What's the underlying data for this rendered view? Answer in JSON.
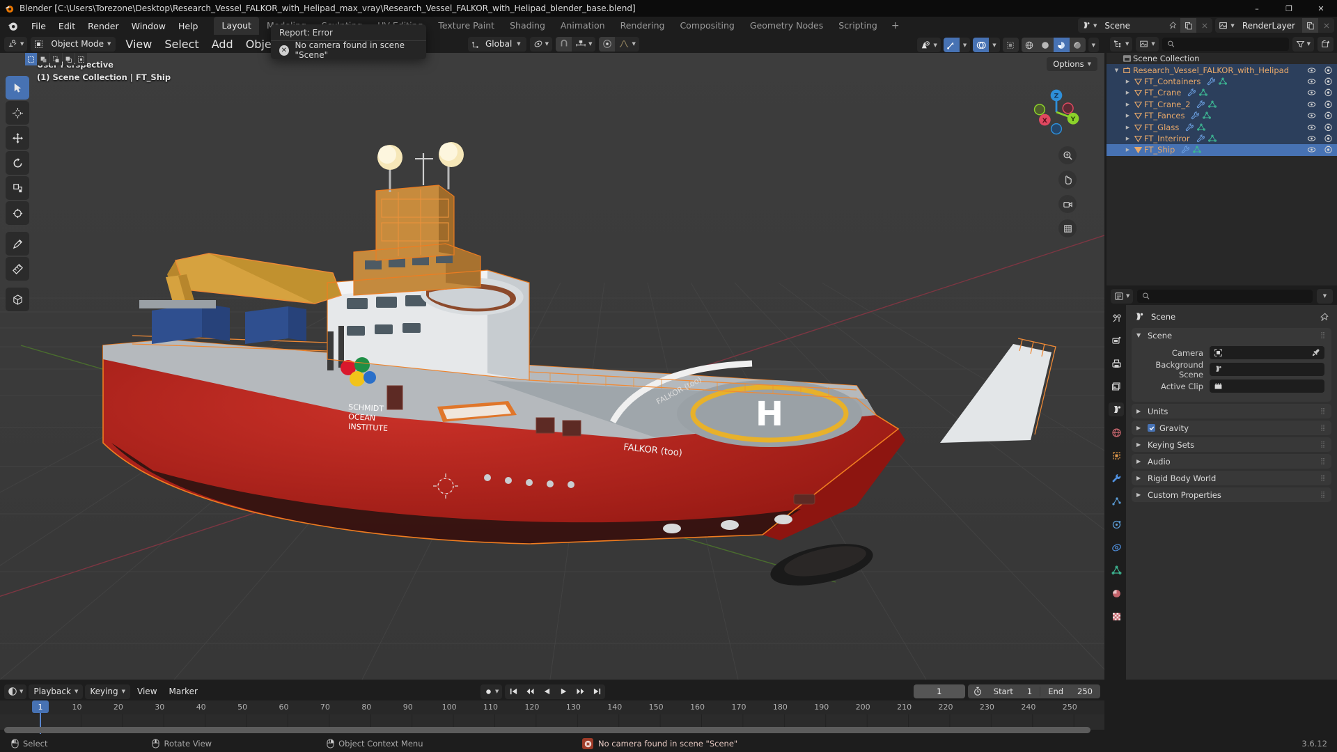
{
  "window": {
    "title": "Blender [C:\\Users\\Torezone\\Desktop\\Research_Vessel_FALKOR_with_Helipad_max_vray\\Research_Vessel_FALKOR_with_Helipad_blender_base.blend]",
    "minimize": "–",
    "maximize": "❐",
    "close": "✕"
  },
  "topbar": {
    "menus": [
      "File",
      "Edit",
      "Render",
      "Window",
      "Help"
    ],
    "workspaces": [
      {
        "label": "Layout",
        "active": true
      },
      {
        "label": "Modeling",
        "active": false
      },
      {
        "label": "Sculpting",
        "active": false
      },
      {
        "label": "UV Editing",
        "active": false
      },
      {
        "label": "Texture Paint",
        "active": false
      },
      {
        "label": "Shading",
        "active": false
      },
      {
        "label": "Animation",
        "active": false
      },
      {
        "label": "Rendering",
        "active": false
      },
      {
        "label": "Compositing",
        "active": false
      },
      {
        "label": "Geometry Nodes",
        "active": false
      },
      {
        "label": "Scripting",
        "active": false
      }
    ],
    "add_workspace": "+",
    "scene_name": "Scene",
    "view_layer_name": "RenderLayer"
  },
  "error_popup": {
    "title": "Report: Error",
    "message": "No camera found in scene \"Scene\"",
    "icon": "error-icon"
  },
  "viewport": {
    "mode": "Object Mode",
    "menus": [
      "View",
      "Select",
      "Add",
      "Object"
    ],
    "transform_orientation": "Global",
    "options_label": "Options",
    "overlay_line1": "User Perspective",
    "overlay_line2": "(1) Scene Collection | FT_Ship",
    "gizmo_axes": {
      "x": "X",
      "y": "Y",
      "z": "Z"
    },
    "axis_colors": {
      "x": "#e04860",
      "y": "#8bd22a",
      "z": "#2e8fd9"
    }
  },
  "outliner": {
    "search_placeholder": "",
    "root": "Scene Collection",
    "rows": [
      {
        "label": "Research_Vessel_FALKOR_with_Helipad",
        "type": "collection",
        "indent": 0,
        "state": "selected",
        "expanded": true,
        "data_icons": []
      },
      {
        "label": "FT_Containers",
        "type": "object",
        "indent": 1,
        "state": "selected",
        "expanded": false,
        "data_icons": [
          "modifier-icon",
          "mesh-data-icon"
        ]
      },
      {
        "label": "FT_Crane",
        "type": "object",
        "indent": 1,
        "state": "selected",
        "expanded": false,
        "data_icons": [
          "modifier-icon",
          "mesh-data-icon"
        ]
      },
      {
        "label": "FT_Crane_2",
        "type": "object",
        "indent": 1,
        "state": "selected",
        "expanded": false,
        "data_icons": [
          "modifier-icon",
          "mesh-data-icon"
        ]
      },
      {
        "label": "FT_Fances",
        "type": "object",
        "indent": 1,
        "state": "selected",
        "expanded": false,
        "data_icons": [
          "modifier-icon",
          "mesh-data-icon"
        ]
      },
      {
        "label": "FT_Glass",
        "type": "object",
        "indent": 1,
        "state": "selected",
        "expanded": false,
        "data_icons": [
          "modifier-icon",
          "mesh-data-icon"
        ]
      },
      {
        "label": "FT_Interiror",
        "type": "object",
        "indent": 1,
        "state": "selected",
        "expanded": false,
        "data_icons": [
          "modifier-icon",
          "mesh-data-icon"
        ]
      },
      {
        "label": "FT_Ship",
        "type": "object",
        "indent": 1,
        "state": "active",
        "expanded": false,
        "data_icons": [
          "modifier-icon",
          "mesh-data-icon"
        ]
      }
    ]
  },
  "properties": {
    "search_placeholder": "",
    "breadcrumb": "Scene",
    "tabs": [
      {
        "name": "tool-icon",
        "active": false
      },
      {
        "name": "render-icon",
        "active": false
      },
      {
        "name": "output-icon",
        "active": false
      },
      {
        "name": "view-layer-icon",
        "active": false
      },
      {
        "name": "scene-icon",
        "active": true
      },
      {
        "name": "world-icon",
        "active": false
      },
      {
        "name": "object-icon",
        "active": false
      },
      {
        "name": "modifier-icon",
        "active": false
      },
      {
        "name": "particles-icon",
        "active": false
      },
      {
        "name": "physics-icon",
        "active": false
      },
      {
        "name": "constraints-icon",
        "active": false
      },
      {
        "name": "object-data-icon",
        "active": false
      },
      {
        "name": "material-icon",
        "active": false
      },
      {
        "name": "texture-icon",
        "active": false
      }
    ],
    "panels": [
      {
        "label": "Scene",
        "open": true,
        "checkbox": null
      },
      {
        "label": "Units",
        "open": false,
        "checkbox": null
      },
      {
        "label": "Gravity",
        "open": false,
        "checkbox": true
      },
      {
        "label": "Keying Sets",
        "open": false,
        "checkbox": null
      },
      {
        "label": "Audio",
        "open": false,
        "checkbox": null
      },
      {
        "label": "Rigid Body World",
        "open": false,
        "checkbox": null
      },
      {
        "label": "Custom Properties",
        "open": false,
        "checkbox": null
      }
    ],
    "scene_fields": [
      {
        "label": "Camera",
        "value": "",
        "icon": "camera-icon",
        "eyedropper": true
      },
      {
        "label": "Background Scene",
        "value": "",
        "icon": "scene-icon",
        "eyedropper": false
      },
      {
        "label": "Active Clip",
        "value": "",
        "icon": "clip-icon",
        "eyedropper": false
      }
    ]
  },
  "timeline": {
    "menus": [
      "Playback",
      "Keying",
      "View",
      "Marker"
    ],
    "current_frame": "1",
    "start_label": "Start",
    "start_value": "1",
    "end_label": "End",
    "end_value": "250",
    "ruler_ticks": [
      "10",
      "20",
      "30",
      "40",
      "50",
      "60",
      "70",
      "80",
      "90",
      "100",
      "110",
      "120",
      "130",
      "140",
      "150",
      "160",
      "170",
      "180",
      "190",
      "200",
      "210",
      "220",
      "230",
      "240",
      "250"
    ],
    "playhead_frame": "1"
  },
  "statusbar": {
    "items": [
      {
        "label": "Select",
        "icon": "mouse-left-icon"
      },
      {
        "label": "Rotate View",
        "icon": "mouse-middle-icon"
      },
      {
        "label": "Object Context Menu",
        "icon": "mouse-right-icon"
      }
    ],
    "error_message": "No camera found in scene \"Scene\"",
    "version": "3.6.12"
  }
}
